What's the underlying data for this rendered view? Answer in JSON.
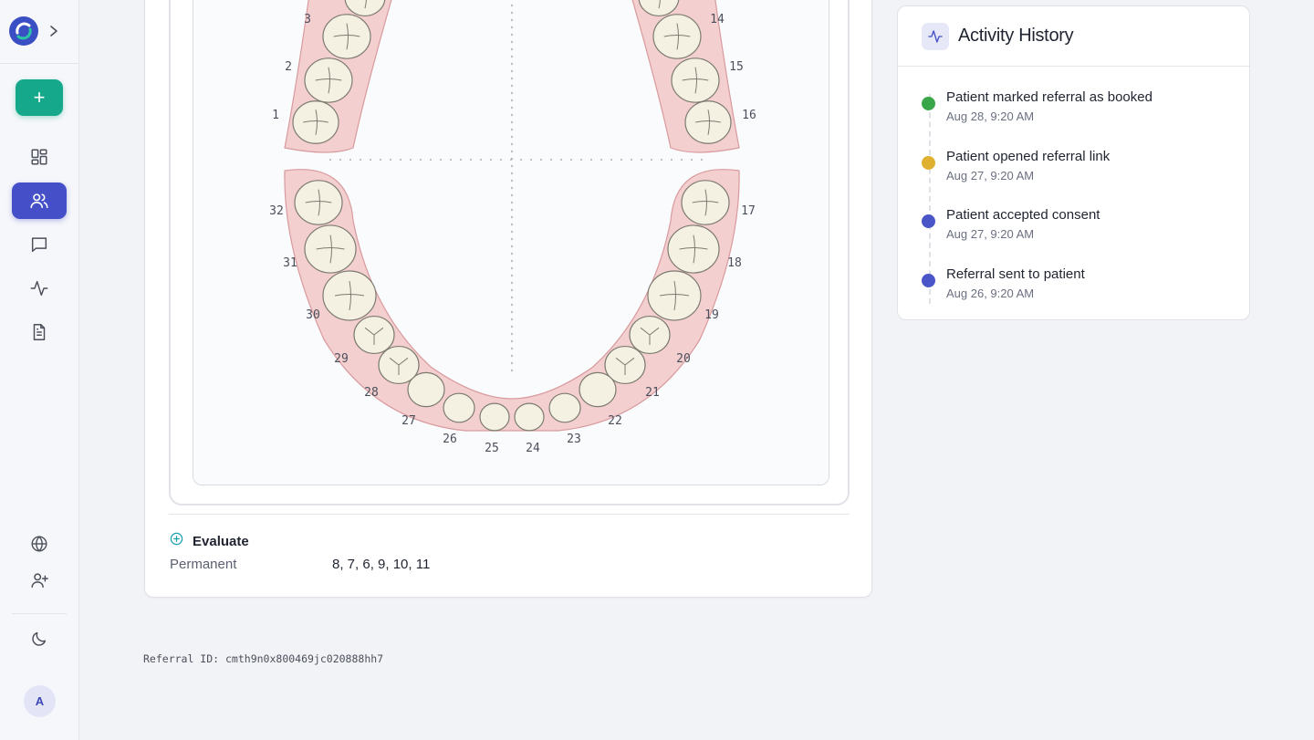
{
  "sidebar": {
    "avatar_initial": "A",
    "new_label": "+",
    "nav": [
      {
        "icon": "dashboard-icon",
        "active": false
      },
      {
        "icon": "users-icon",
        "active": true
      },
      {
        "icon": "messages-icon",
        "active": false
      },
      {
        "icon": "activity-icon",
        "active": false
      },
      {
        "icon": "document-icon",
        "active": false
      }
    ],
    "bottom": [
      "globe-icon",
      "add-user-icon",
      "moon-icon"
    ]
  },
  "tooth_chart": {
    "upper_visible": [
      "1",
      "2",
      "3",
      "14",
      "15",
      "16"
    ],
    "lower": [
      "17",
      "18",
      "19",
      "20",
      "21",
      "22",
      "23",
      "24",
      "25",
      "26",
      "27",
      "28",
      "29",
      "30",
      "31",
      "32"
    ]
  },
  "evaluation": {
    "title": "Evaluate",
    "dentition_label": "Permanent",
    "teeth_value": "8, 7, 6, 9, 10, 11"
  },
  "referral": {
    "id_text": "Referral ID: cmth9n0x800469jc020888hh7"
  },
  "activity": {
    "title": "Activity History",
    "items": [
      {
        "title": "Patient marked referral as booked",
        "time": "Aug 28, 9:20 AM",
        "color": "#3aa64a"
      },
      {
        "title": "Patient opened referral link",
        "time": "Aug 27, 9:20 AM",
        "color": "#e0b030"
      },
      {
        "title": "Patient accepted consent",
        "time": "Aug 27, 9:20 AM",
        "color": "#4a55c8"
      },
      {
        "title": "Referral sent to patient",
        "time": "Aug 26, 9:20 AM",
        "color": "#4a55c8"
      }
    ]
  }
}
